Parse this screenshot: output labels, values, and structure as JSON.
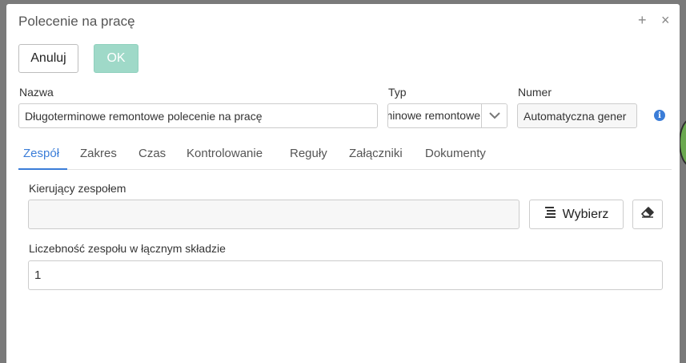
{
  "dialog": {
    "title": "Polecenie na pracę"
  },
  "header_icons": {
    "expand": "+",
    "close": "×"
  },
  "toolbar": {
    "cancel_label": "Anuluj",
    "ok_label": "OK"
  },
  "fields": {
    "nazwa": {
      "label": "Nazwa",
      "value": "Długoterminowe remontowe polecenie na pracę"
    },
    "typ": {
      "label": "Typ",
      "value": "Długoterminowe remontowe"
    },
    "numer": {
      "label": "Numer",
      "value": "Automatyczna gener"
    }
  },
  "tabs": [
    {
      "label": "Zespół",
      "active": true
    },
    {
      "label": "Zakres"
    },
    {
      "label": "Czas"
    },
    {
      "label": "Kontrolowanie"
    },
    {
      "label": "Reguły"
    },
    {
      "label": "Załączniki"
    },
    {
      "label": "Dokumenty"
    }
  ],
  "team": {
    "leader_label": "Kierujący zespołem",
    "leader_value": "",
    "select_button": "Wybierz",
    "count_label": "Liczebność zespołu w łącznym składzie",
    "count_value": "1"
  },
  "colors": {
    "accent": "#3b7dd8",
    "ok_button": "#9fd9c8",
    "backdrop": "#7a7a7a"
  },
  "icons": [
    "plus-icon",
    "close-icon",
    "chevron-down-icon",
    "info-icon",
    "list-icon",
    "eraser-icon"
  ]
}
